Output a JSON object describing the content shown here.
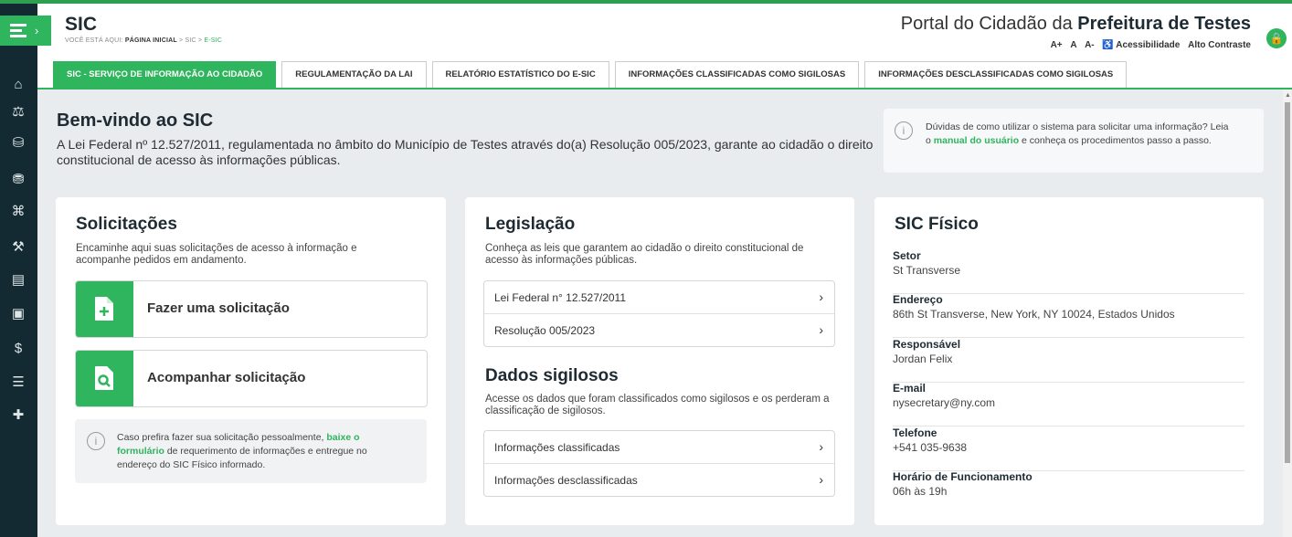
{
  "header": {
    "title": "SIC",
    "breadcrumb": {
      "prefix": "VOCÊ ESTÁ AQUI:",
      "home": "PÁGINA INICIAL",
      "sep": ">",
      "sic": "SIC",
      "current": "E-SIC"
    },
    "portal_prefix": "Portal do Cidadão da",
    "portal_bold": "Prefeitura de Testes",
    "accessibility": {
      "a_plus": "A+",
      "a": "A",
      "a_minus": "A-",
      "acess": "Acessibilidade",
      "contrast": "Alto Contraste"
    }
  },
  "tabs": [
    {
      "label": "SIC - SERVIÇO DE INFORMAÇÃO AO CIDADÃO",
      "active": true
    },
    {
      "label": "REGULAMENTAÇÃO DA LAI"
    },
    {
      "label": "RELATÓRIO ESTATÍSTICO DO E-SIC"
    },
    {
      "label": "INFORMAÇÕES CLASSIFICADAS COMO SIGILOSAS"
    },
    {
      "label": "INFORMAÇÕES DESCLASSIFICADAS COMO SIGILOSAS"
    }
  ],
  "sidebar": {
    "icons": [
      "home-icon",
      "scale-icon",
      "coins-icon",
      "coins-stack-icon",
      "building-icon",
      "gavel-icon",
      "document-icon",
      "report-icon",
      "money-icon",
      "chat-icon",
      "plus-cross-icon"
    ]
  },
  "welcome": {
    "title": "Bem-vindo ao SIC",
    "text": "A Lei Federal nº 12.527/2011, regulamentada no âmbito do Município de Testes através do(a) Resolução 005/2023, garante ao cidadão o direito constitucional de acesso às informações públicas."
  },
  "help": {
    "before": "Dúvidas de como utilizar o sistema para solicitar uma informação? Leia o ",
    "link": "manual do usuário",
    "after": " e conheça os procedimentos passo a passo."
  },
  "solicitacoes": {
    "title": "Solicitações",
    "desc": "Encaminhe aqui suas solicitações de acesso à informação e acompanhe pedidos em andamento.",
    "make": "Fazer uma solicitação",
    "track": "Acompanhar solicitação",
    "note_before": "Caso prefira fazer sua solicitação pessoalmente, ",
    "note_link": "baixe o formulário",
    "note_after": " de requerimento de informações e entregue no endereço do SIC Físico informado."
  },
  "legislacao": {
    "title": "Legislação",
    "desc": "Conheça as leis que garantem ao cidadão o direito constitucional de acesso às informações públicas.",
    "items": [
      "Lei Federal n° 12.527/2011",
      "Resolução 005/2023"
    ]
  },
  "sigilosos": {
    "title": "Dados sigilosos",
    "desc": "Acesse os dados que foram classificados como sigilosos e os perderam a classificação de sigilosos.",
    "items": [
      "Informações classificadas",
      "Informações desclassificadas"
    ]
  },
  "fisico": {
    "title": "SIC Físico",
    "fields": [
      {
        "label": "Setor",
        "value": "St Transverse"
      },
      {
        "label": "Endereço",
        "value": "86th St Transverse, New York, NY 10024, Estados Unidos"
      },
      {
        "label": "Responsável",
        "value": "Jordan Felix"
      },
      {
        "label": "E-mail",
        "value": "nysecretary@ny.com"
      },
      {
        "label": "Telefone",
        "value": "+541 035-9638"
      },
      {
        "label": "Horário de Funcionamento",
        "value": "06h às 19h"
      }
    ]
  },
  "colors": {
    "accent": "#2fb55d",
    "sidebar": "#142a33",
    "background": "#e9ecef"
  }
}
